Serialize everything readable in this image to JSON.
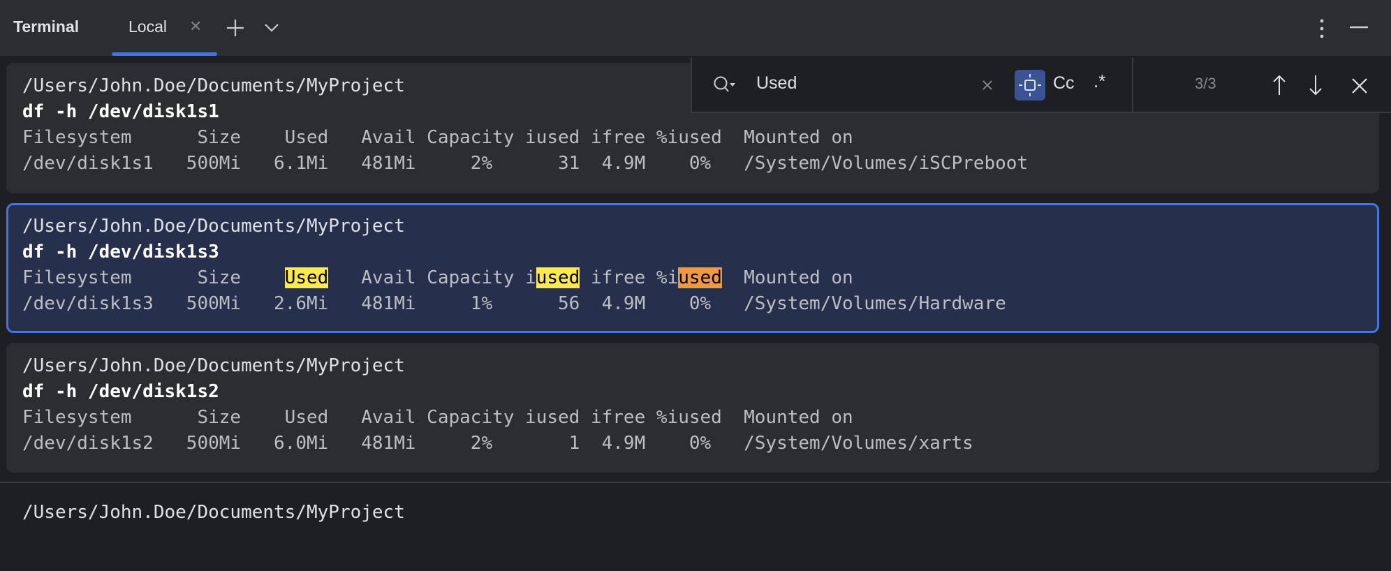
{
  "header": {
    "title": "Terminal",
    "tabs": [
      {
        "label": "Local",
        "active": true
      }
    ],
    "icons": [
      "close-icon",
      "plus-icon",
      "chevron-down-icon",
      "kebab-menu-icon",
      "minimize-icon"
    ]
  },
  "search": {
    "query": "Used",
    "match_count": "3/3",
    "case_label": "Cc",
    "regex_label": ".*",
    "colors": {
      "match": "#fee94a",
      "current_match": "#f0993f"
    }
  },
  "blocks": [
    {
      "prompt": "/Users/John.Doe/Documents/MyProject",
      "command": "df -h /dev/disk1s1",
      "header": "Filesystem      Size    Used   Avail Capacity iused ifree %iused  Mounted on",
      "row": "/dev/disk1s1   500Mi   6.1Mi   481Mi     2%      31  4.9M    0%   /System/Volumes/iSCPreboot"
    },
    {
      "prompt": "/Users/John.Doe/Documents/MyProject",
      "command": "df -h /dev/disk1s3",
      "header_segments": [
        "Filesystem      Size    ",
        "Used",
        "   Avail Capacity i",
        "used",
        " ifree %i",
        "used",
        "  Mounted on"
      ],
      "row": "/dev/disk1s3   500Mi   2.6Mi   481Mi     1%      56  4.9M    0%   /System/Volumes/Hardware",
      "selected": true
    },
    {
      "prompt": "/Users/John.Doe/Documents/MyProject",
      "command": "df -h /dev/disk1s2",
      "header": "Filesystem      Size    Used   Avail Capacity iused ifree %iused  Mounted on",
      "row": "/dev/disk1s2   500Mi   6.0Mi   481Mi     2%       1  4.9M    0%   /System/Volumes/xarts"
    }
  ],
  "current_prompt": "/Users/John.Doe/Documents/MyProject"
}
